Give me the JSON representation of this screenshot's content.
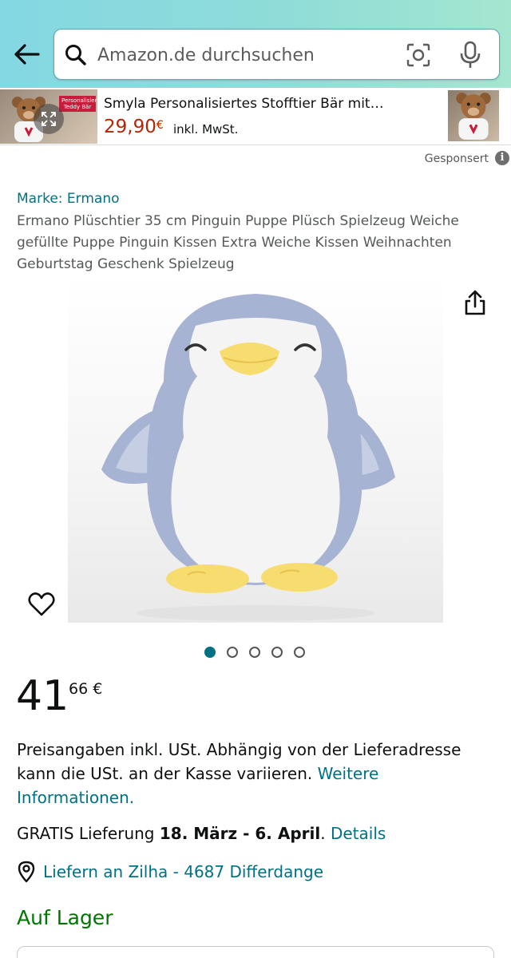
{
  "search": {
    "placeholder": "Amazon.de durchsuchen"
  },
  "sponsored_ad": {
    "thumbnail_tag": "Personalisierter Teddy Bär",
    "title": "Smyla Personalisiertes Stofftier Bär mit…",
    "price": "29,90",
    "currency": "€",
    "vat_note": "inkl. MwSt.",
    "sponsored_label": "Gesponsert",
    "info_icon": "i"
  },
  "product": {
    "brand": "Marke: Ermano",
    "title": "Ermano Plüschtier 35 cm Pinguin Puppe Plüsch Spielzeug Weiche gefüllte Puppe Pinguin Kissen Extra Weiche Kissen Weihnachten Geburtstag Geschenk Spielzeug",
    "image_count": 5,
    "active_image_index": 0,
    "price_whole": "41",
    "price_fraction": "66 €",
    "tax_text": "Preisangaben inkl. USt. Abhängig von der Lieferadresse kann die USt. an der Kasse variieren.",
    "tax_link": "Weitere Informationen.",
    "delivery_prefix": "GRATIS Lieferung",
    "delivery_dates": "18. März - 6. April",
    "delivery_suffix": ".",
    "delivery_link": "Details",
    "location": "Liefern an Zilha - 4687 Differdange",
    "stock": "Auf Lager"
  },
  "icons": {
    "back": "arrow-left-icon",
    "search": "search-icon",
    "camera": "camera-lens-icon",
    "mic": "microphone-icon",
    "share": "share-icon",
    "wishlist": "heart-icon",
    "location": "location-pin-icon",
    "expand": "expand-icon"
  },
  "colors": {
    "header_gradient_start": "#84d8e3",
    "header_gradient_end": "#a4e6cf",
    "link": "#007185",
    "sponsored_price": "#b12704",
    "stock": "#007600",
    "penguin_body": "#a7b3d2",
    "penguin_beak": "#f7dc6f"
  }
}
